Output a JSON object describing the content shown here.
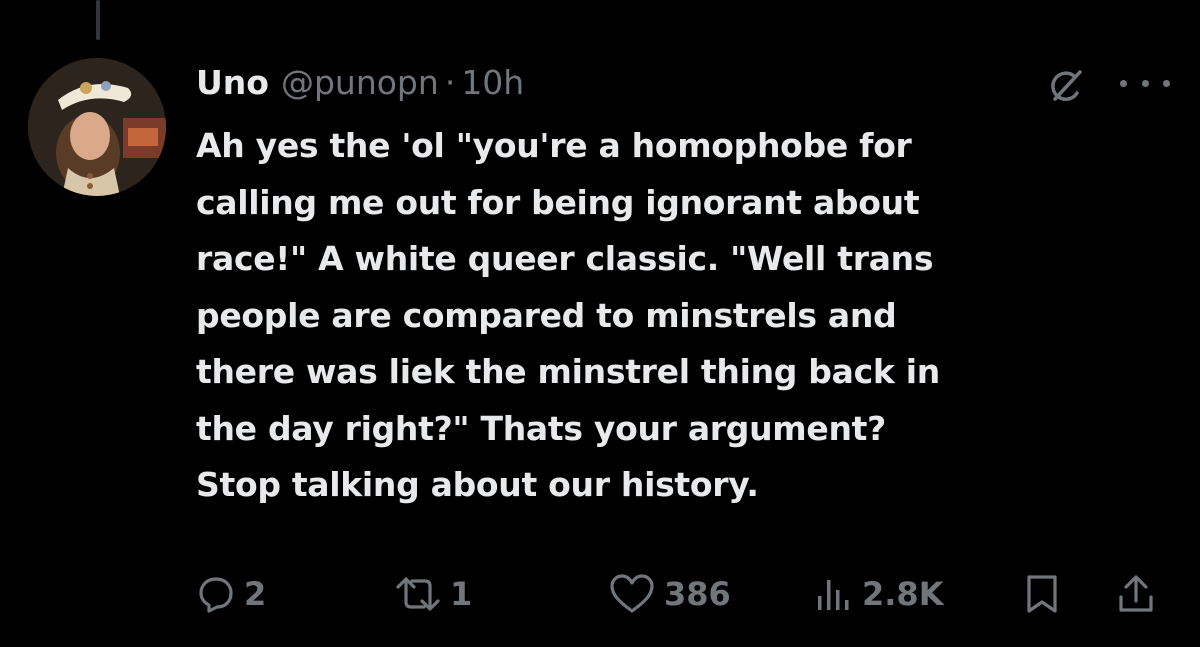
{
  "tweet": {
    "display_name": "Uno",
    "handle": "@punopn",
    "separator": "·",
    "time": "10h",
    "text_lines": [
      "Ah yes the 'ol \"you're a homophobe for",
      "calling me out for being ignorant about",
      "race!\" A white queer classic. \"Well trans",
      "people are compared to minstrels and",
      "there was liek the minstrel thing back in",
      "the day right?\" Thats your argument?",
      "Stop talking about our history."
    ]
  },
  "actions": {
    "replies": "2",
    "reposts": "1",
    "likes": "386",
    "views": "2.8K"
  },
  "icons": [
    "reply-icon",
    "repost-icon",
    "like-icon",
    "views-icon",
    "bookmark-icon",
    "share-icon",
    "grok-icon",
    "more-icon"
  ],
  "colors": {
    "background": "#000000",
    "text": "#e7e9ea",
    "secondary": "#71767b"
  }
}
